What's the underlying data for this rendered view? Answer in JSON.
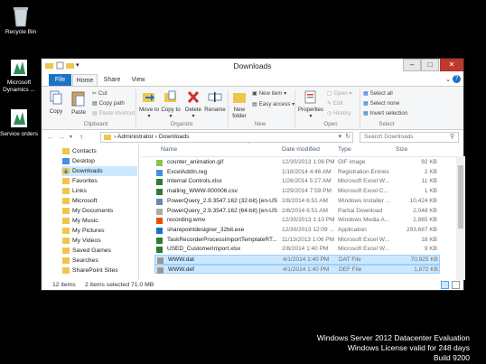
{
  "desktop": {
    "icons": [
      {
        "label": "Recycle Bin"
      },
      {
        "label": "Microsoft Dynamics ..."
      },
      {
        "label": "Service orders"
      }
    ],
    "watermark": {
      "line1": "Windows Server 2012 Datacenter Evaluation",
      "line2": "Windows License valid for 248 days",
      "line3": "Build 9200"
    }
  },
  "window": {
    "title": "Downloads",
    "tabs": {
      "file": "File",
      "home": "Home",
      "share": "Share",
      "view": "View"
    },
    "ribbon": {
      "copy": "Copy",
      "paste": "Paste",
      "cut": "Cut",
      "copy_path": "Copy path",
      "paste_shortcut": "Paste shortcut",
      "clipboard": "Clipboard",
      "move_to": "Move to",
      "copy_to": "Copy to",
      "delete": "Delete",
      "rename": "Rename",
      "organize": "Organize",
      "new_folder": "New folder",
      "new_item": "New item",
      "easy_access": "Easy access",
      "new": "New",
      "properties": "Properties",
      "open": "Open",
      "edit": "Edit",
      "history": "History",
      "open_group": "Open",
      "select_all": "Select all",
      "select_none": "Select none",
      "invert_selection": "Invert selection",
      "select": "Select"
    },
    "address": {
      "part1": "Administrator",
      "part2": "Downloads"
    },
    "search_placeholder": "Search Downloads",
    "nav": [
      {
        "label": "Contacts"
      },
      {
        "label": "Desktop"
      },
      {
        "label": "Downloads"
      },
      {
        "label": "Favorites"
      },
      {
        "label": "Links"
      },
      {
        "label": "Microsoft"
      },
      {
        "label": "My Documents"
      },
      {
        "label": "My Music"
      },
      {
        "label": "My Pictures"
      },
      {
        "label": "My Videos"
      },
      {
        "label": "Saved Games"
      },
      {
        "label": "Searches"
      },
      {
        "label": "SharePoint Sites"
      }
    ],
    "columns": {
      "name": "Name",
      "date": "Date modified",
      "type": "Type",
      "size": "Size"
    },
    "files": [
      {
        "name": "counter_animation.gif",
        "date": "12/30/2013 1:06 PM",
        "type": "GIF image",
        "size": "92 KB"
      },
      {
        "name": "ExcelAddIn.reg",
        "date": "1/16/2014 4:46 AM",
        "type": "Registration Entries",
        "size": "2 KB"
      },
      {
        "name": "Internal Controls.xlsx",
        "date": "1/26/2014 5:27 AM",
        "type": "Microsoft Excel W...",
        "size": "11 KB"
      },
      {
        "name": "mailing_WWW-000006.csv",
        "date": "1/29/2014 7:59 PM",
        "type": "Microsoft Excel C...",
        "size": "1 KB"
      },
      {
        "name": "PowerQuery_2.9.3547.162 (32-bit) [en-US...",
        "date": "2/8/2014 6:51 AM",
        "type": "Windows Installer ...",
        "size": "10,424 KB"
      },
      {
        "name": "PowerQuery_2.9.3547.162 (64-bit) [en-US...",
        "date": "2/8/2014 6:51 AM",
        "type": "Partial Download",
        "size": "2,048 KB"
      },
      {
        "name": "recording.wmv",
        "date": "12/30/2013 1:10 PM",
        "type": "Windows Media A...",
        "size": "2,885 KB"
      },
      {
        "name": "sharepointdesigner_32bit.exe",
        "date": "12/30/2013 12:09 ...",
        "type": "Application",
        "size": "293,687 KB"
      },
      {
        "name": "TaskRecorderProcessImportTemplateRT...",
        "date": "11/13/2013 1:06 PM",
        "type": "Microsoft Excel W...",
        "size": "18 KB"
      },
      {
        "name": "USED_CustomerImport.xlsx",
        "date": "2/8/2014 1:40 PM",
        "type": "Microsoft Excel W...",
        "size": "9 KB"
      },
      {
        "name": "WWW.dat",
        "date": "4/1/2014 1:40 PM",
        "type": "DAT File",
        "size": "70,925 KB",
        "selected": true
      },
      {
        "name": "WWW.def",
        "date": "4/1/2014 1:40 PM",
        "type": "DEF File",
        "size": "1,872 KB",
        "selected": true
      }
    ],
    "status": {
      "items": "12 items",
      "selected": "2 items selected  71.0 MB"
    }
  },
  "colors": {
    "accent": "#1e72c6",
    "selection": "#cce8ff",
    "close": "#c0392b"
  }
}
